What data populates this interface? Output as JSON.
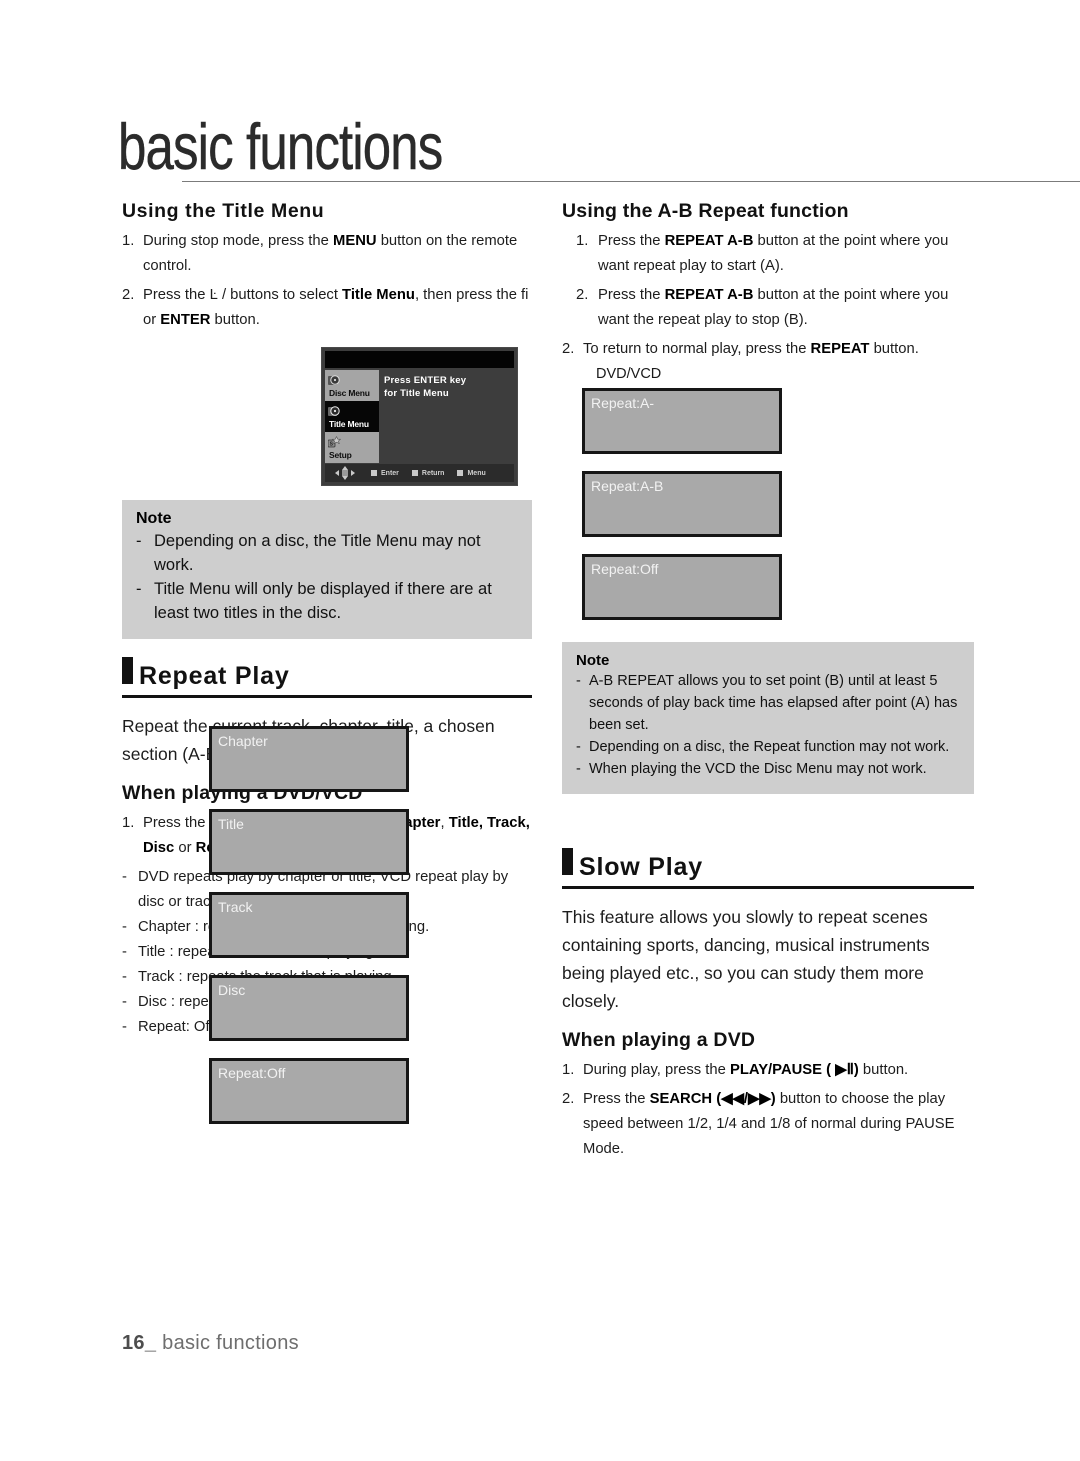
{
  "page": {
    "title": "basic functions",
    "footer_page_number": "16_",
    "footer_section": "basic functions"
  },
  "left_column": {
    "title_menu": {
      "heading": "Using the Title Menu",
      "steps": [
        {
          "num": "1.",
          "parts": [
            {
              "t": "During stop mode, press the ",
              "b": false
            },
            {
              "t": "MENU",
              "b": true
            },
            {
              "t": " button on the remote control.",
              "b": false
            }
          ]
        },
        {
          "num": "2.",
          "parts": [
            {
              "t": "Press the Ŀ /   buttons to select ",
              "b": false
            },
            {
              "t": "Title Menu",
              "b": true
            },
            {
              "t": ", then press the fi  or ",
              "b": false
            },
            {
              "t": "ENTER",
              "b": true
            },
            {
              "t": " button.",
              "b": false
            }
          ]
        }
      ],
      "tv_screen": {
        "menu_items": [
          {
            "label": "Disc Menu",
            "icon": "disc-icon",
            "selected": false
          },
          {
            "label": "Title Menu",
            "icon": "title-icon",
            "selected": true
          },
          {
            "label": "Setup",
            "icon": "setup-icon",
            "selected": false
          }
        ],
        "message_line1": "Press ENTER key",
        "message_line2": "for Title Menu",
        "nav_hints": [
          "Enter",
          "Return",
          "Menu"
        ]
      },
      "note": {
        "title": "Note",
        "items": [
          "Depending on a disc, the Title Menu may not work.",
          "Title Menu will only be displayed if there are at least two titles in the disc."
        ]
      }
    },
    "repeat_play": {
      "banner": "Repeat Play",
      "intro": "Repeat the current track, chapter, title, a chosen section (A-B), or all of the disc.",
      "sub_heading": "When playing a DVD/VCD",
      "step1": {
        "num": "1.",
        "parts": [
          {
            "t": "Press the ",
            "b": false
          },
          {
            "t": "REPEAT",
            "b": true
          },
          {
            "t": " buttons to select ",
            "b": false
          },
          {
            "t": "Chapter",
            "b": true
          },
          {
            "t": ", ",
            "b": false
          },
          {
            "t": "Title, Track, Disc",
            "b": true
          },
          {
            "t": " or ",
            "b": false
          },
          {
            "t": "Repeat:Off",
            "b": true
          }
        ]
      },
      "bullets": [
        "DVD repeats play by chapter or title, VCD repeat play by disc or track.",
        "Chapter : repeats the chapter that is playing.",
        "Title : repeats the title that is playing.",
        "Track : repeats the track that is playing.",
        "Disc : repeats the disc that is playing.",
        "Repeat: Off"
      ],
      "osd_boxes": [
        "Chapter",
        "Title",
        "Track",
        "Disc",
        "Repeat:Off"
      ]
    }
  },
  "right_column": {
    "ab_repeat": {
      "heading": "Using the A-B Repeat function",
      "steps": [
        {
          "num": "1.",
          "indent": true,
          "parts": [
            {
              "t": "Press the ",
              "b": false
            },
            {
              "t": "REPEAT A-B",
              "b": true
            },
            {
              "t": " button at the point where you want repeat play to start (A).",
              "b": false
            }
          ]
        },
        {
          "num": "2.",
          "indent": true,
          "parts": [
            {
              "t": "Press the ",
              "b": false
            },
            {
              "t": "REPEAT A-B",
              "b": true
            },
            {
              "t": " button at the point where you want the repeat play to stop (B).",
              "b": false
            }
          ]
        },
        {
          "num": "2.",
          "indent": false,
          "parts": [
            {
              "t": "To return to normal play, press the ",
              "b": false
            },
            {
              "t": "REPEAT",
              "b": true
            },
            {
              "t": "  button.",
              "b": false
            }
          ]
        }
      ],
      "osd_label": "DVD/VCD",
      "osd_boxes": [
        "Repeat:A-",
        "Repeat:A-B",
        "Repeat:Off"
      ],
      "note": {
        "title": "Note",
        "items": [
          "A-B REPEAT allows you to set point (B) until at least 5 seconds of play back time has elapsed after point (A) has been set.",
          "Depending on a disc, the Repeat function may not work.",
          "When playing the VCD the Disc Menu may not work."
        ]
      }
    },
    "slow_play": {
      "banner": "Slow Play",
      "intro": "This feature allows you slowly to repeat scenes containing sports, dancing, musical instruments being played etc., so you can study them more closely.",
      "sub_heading": "When playing a DVD",
      "steps": [
        {
          "num": "1.",
          "parts": [
            {
              "t": "During play, press the ",
              "b": false
            },
            {
              "t": "PLAY/PAUSE ( ▶Ⅱ)",
              "b": true
            },
            {
              "t": " button.",
              "b": false
            }
          ]
        },
        {
          "num": "2.",
          "parts": [
            {
              "t": "Press the ",
              "b": false
            },
            {
              "t": "SEARCH (◀◀/▶▶)",
              "b": true
            },
            {
              "t": " button to choose the play speed between 1/2, 1/4 and 1/8 of normal during PAUSE Mode.",
              "b": false
            }
          ]
        }
      ]
    }
  },
  "colors": {
    "note_background": "#cecece",
    "osd_fill": "#a9a9a9",
    "osd_border": "#161616",
    "banner_accent": "#121212"
  }
}
